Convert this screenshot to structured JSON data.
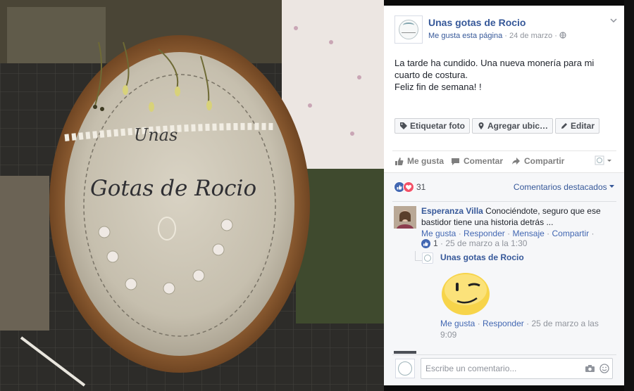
{
  "post": {
    "page_name": "Unas gotas de Rocio",
    "like_page": "Me gusta esta página",
    "separator": "·",
    "date": "24 de marzo",
    "text_line1": "La tarde ha cundido. Una nueva monería para mi",
    "text_line2": "cuarto de costura.",
    "text_line3": "Feliz fin de semana! !"
  },
  "photo_actions": {
    "tag": "Etiquetar foto",
    "location": "Agregar ubic…",
    "edit": "Editar"
  },
  "ufi": {
    "like": "Me gusta",
    "comment": "Comentar",
    "share": "Compartir"
  },
  "reactions": {
    "count": "31",
    "sort": "Comentarios destacados"
  },
  "comment1": {
    "author": "Esperanza Villa",
    "text": "Conociéndote, seguro que ese bastidor tiene una historia detrás ...",
    "like": "Me gusta",
    "reply": "Responder",
    "message": "Mensaje",
    "share": "Compartir",
    "dot": "·",
    "likes": "1",
    "time": "25 de marzo a la 1:30"
  },
  "reply1": {
    "author": "Unas gotas de Rocio",
    "like": "Me gusta",
    "reply": "Responder",
    "time_line1": "25 de marzo a las",
    "time_line2": "9:09"
  },
  "composer": {
    "placeholder": "Escribe un comentario..."
  },
  "embroidery": {
    "line1": "Unas",
    "line2": "Gotas de Rocio"
  },
  "colors": {
    "link": "#365899",
    "like_blue": "#4267b2",
    "love_red": "#f25268",
    "muted": "#90949c"
  }
}
